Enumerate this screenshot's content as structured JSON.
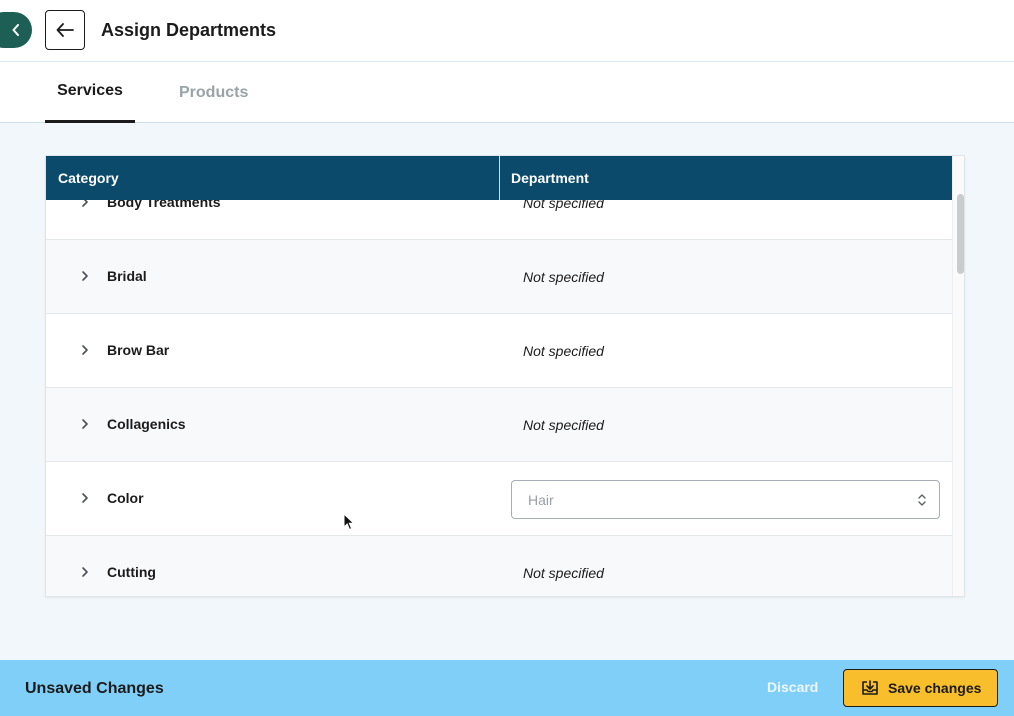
{
  "header": {
    "title": "Assign Departments"
  },
  "tabs": [
    {
      "label": "Services",
      "active": true
    },
    {
      "label": "Products",
      "active": false
    }
  ],
  "table": {
    "columns": {
      "category": "Category",
      "department": "Department"
    },
    "rows": [
      {
        "category": "Body Treatments",
        "department": "Not specified"
      },
      {
        "category": "Bridal",
        "department": "Not specified"
      },
      {
        "category": "Brow Bar",
        "department": "Not specified"
      },
      {
        "category": "Collagenics",
        "department": "Not specified"
      },
      {
        "category": "Color",
        "department": "Hair",
        "select": true
      },
      {
        "category": "Cutting",
        "department": "Not specified"
      }
    ]
  },
  "footer": {
    "status": "Unsaved Changes",
    "discard_label": "Discard",
    "save_label": "Save changes"
  },
  "icons": {
    "collapse": "chevron-left-icon",
    "back": "arrow-left-icon",
    "row_expand": "chevron-right-icon",
    "select_toggle": "chevron-up-down-icon",
    "save": "save-tray-icon"
  },
  "colors": {
    "header_bg": "#0b4a6b",
    "collapse_bg": "#1e5f55",
    "footer_bg": "#80cff8",
    "save_bg": "#f8be2b"
  }
}
